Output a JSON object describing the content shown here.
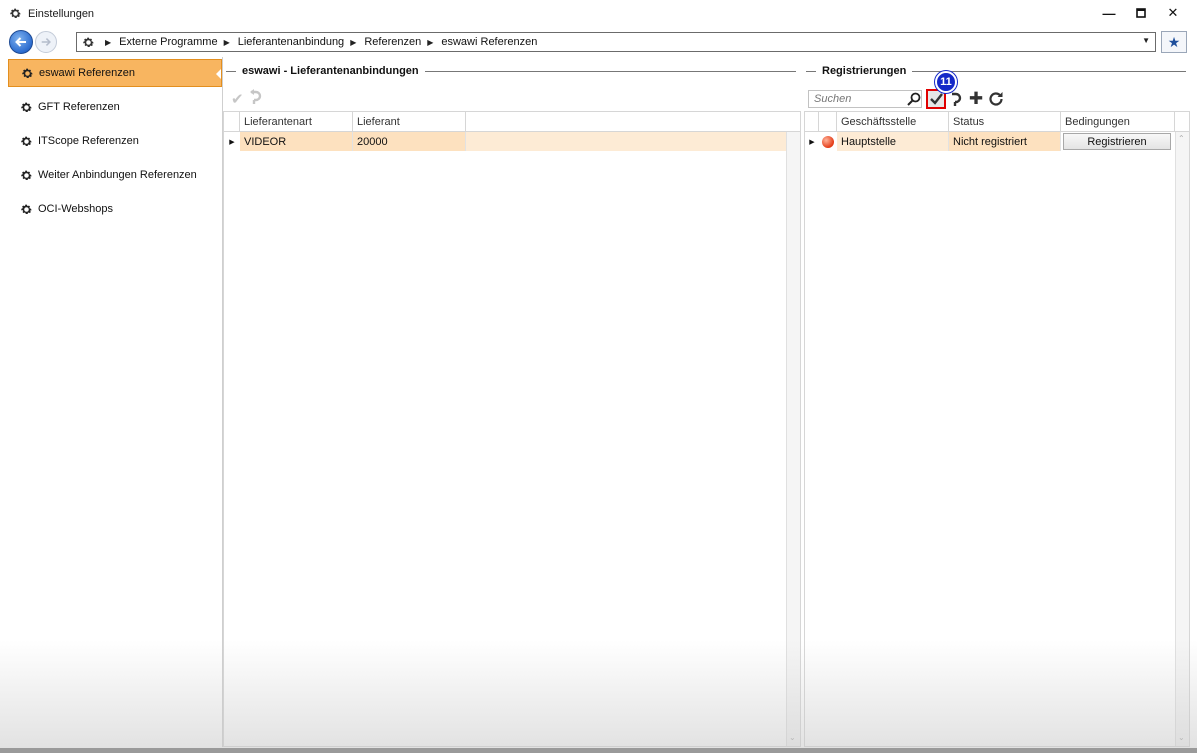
{
  "window": {
    "title": "Einstellungen",
    "minimize_icon": "minimize-icon",
    "maximize_icon": "maximize-icon",
    "close_icon": "close-icon"
  },
  "breadcrumb": {
    "items": [
      "Externe Programme",
      "Lieferantenanbindung",
      "Referenzen",
      "eswawi Referenzen"
    ]
  },
  "sidebar": {
    "items": [
      {
        "label": "eswawi Referenzen",
        "active": true
      },
      {
        "label": "GFT Referenzen"
      },
      {
        "label": "ITScope Referenzen"
      },
      {
        "label": "Weiter Anbindungen Referenzen"
      },
      {
        "label": "OCI-Webshops"
      }
    ]
  },
  "left_section": {
    "title": "eswawi - Lieferantenanbindungen",
    "columns": [
      "Lieferantenart",
      "Lieferant"
    ],
    "rows": [
      {
        "lieferantenart": "VIDEOR",
        "lieferant": "20000"
      }
    ]
  },
  "right_section": {
    "title": "Registrierungen",
    "search_placeholder": "Suchen",
    "step_badge": "11",
    "columns": [
      "Geschäftsstelle",
      "Status",
      "Bedingungen"
    ],
    "rows": [
      {
        "geschaeftsstelle": "Hauptstelle",
        "status": "Nicht registriert",
        "action": "Registrieren"
      }
    ]
  },
  "colors": {
    "active_sidebar": "#f8b560",
    "selected_row": "#fde1bf",
    "highlight_border": "#e00000",
    "badge": "#1428c8"
  }
}
